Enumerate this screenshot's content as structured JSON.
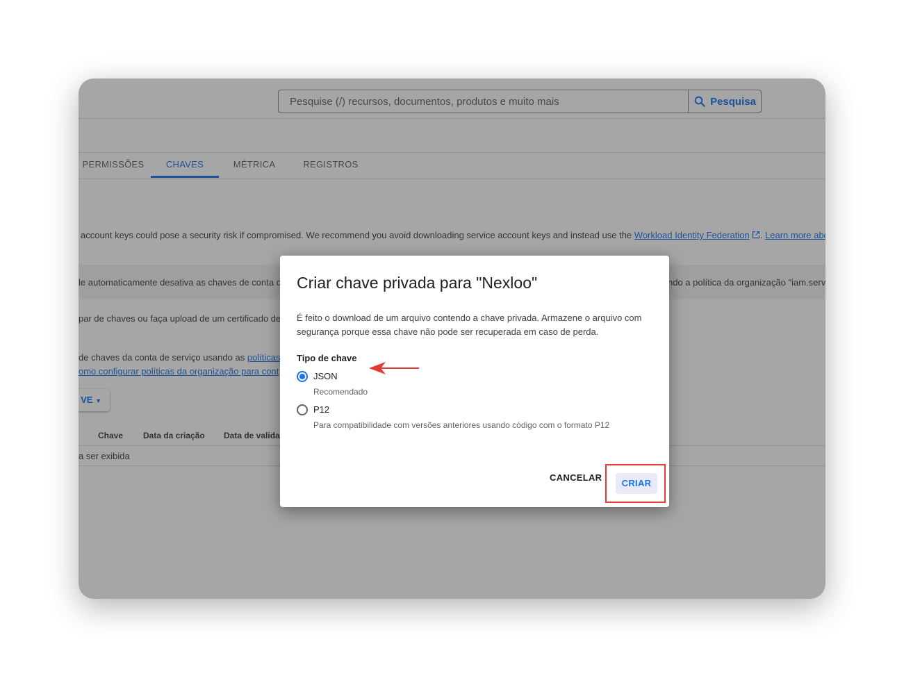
{
  "search": {
    "placeholder": "Pesquise (/) recursos, documentos, produtos e muito mais",
    "button_label": "Pesquisa"
  },
  "tabs": [
    {
      "label": "PERMISSÕES",
      "active": false
    },
    {
      "label": "CHAVES",
      "active": true
    },
    {
      "label": "MÉTRICA",
      "active": false
    },
    {
      "label": "REGISTROS",
      "active": false
    }
  ],
  "background": {
    "warning_text": "account keys could pose a security risk if compromised. We recommend you avoid downloading service account keys and instead use the",
    "warning_link": "Workload Identity Federation",
    "warning_link2": "Learn more abo",
    "banner_left": "le automaticamente desativa as chaves de conta d",
    "banner_right": "ndo a política da organização \"iam.serv",
    "pair_text": "par de chaves ou faça upload de um certificado de",
    "policy_text": "de chaves da conta de serviço usando as",
    "policy_link": "políticas",
    "policy_link2": "omo configurar políticas da organização para cont",
    "add_key_button": "VE",
    "table_headers": [
      "Chave",
      "Data da criação",
      "Data de validad"
    ],
    "empty_row": "a ser exibida"
  },
  "dialog": {
    "title": "Criar chave privada para \"Nexloo\"",
    "description": "É feito o download de um arquivo contendo a chave privada. Armazene o arquivo com segurança porque essa chave não pode ser recuperada em caso de perda.",
    "key_type_label": "Tipo de chave",
    "options": [
      {
        "label": "JSON",
        "help": "Recomendado",
        "selected": true
      },
      {
        "label": "P12",
        "help": "Para compatibilidade com versões anteriores usando código com o formato P12",
        "selected": false
      }
    ],
    "cancel_label": "CANCELAR",
    "create_label": "CRIAR"
  },
  "colors": {
    "accent": "#1a73e8",
    "annotation": "#e53935"
  },
  "icons": [
    "search-icon",
    "external-link-icon",
    "caret-down-icon",
    "arrow-annotation-icon"
  ]
}
